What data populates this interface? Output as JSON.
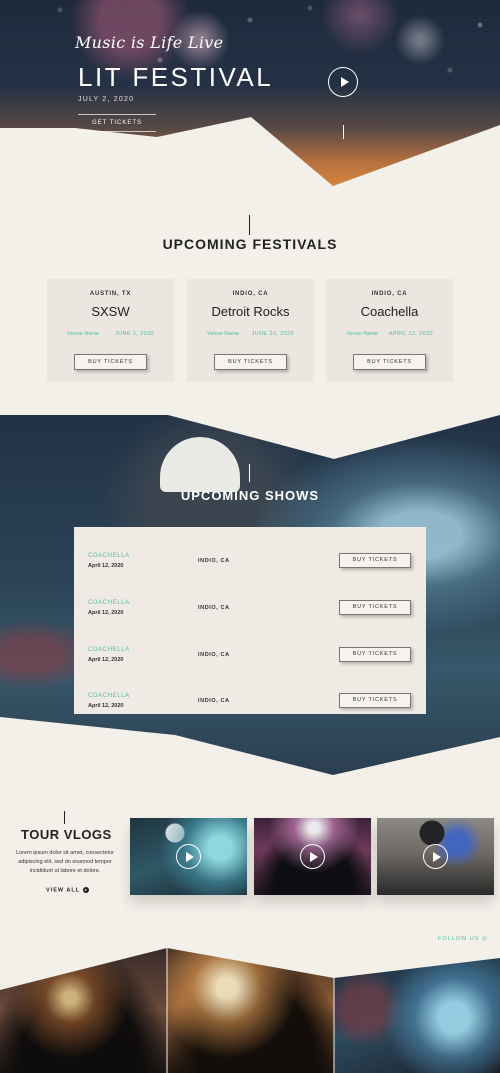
{
  "hero": {
    "tagline": "Music is Life Live",
    "title": "LIT FESTIVAL",
    "date": "JULY 2, 2020",
    "cta": "GET TICKETS"
  },
  "festivals": {
    "title": "UPCOMING FESTIVALS",
    "items": [
      {
        "location": "AUSTIN, TX",
        "name": "SXSW",
        "venue": "Venue Name",
        "date": "JUNE 1, 2020",
        "button": "BUY TICKETS"
      },
      {
        "location": "INDIO, CA",
        "name": "Detroit Rocks",
        "venue": "Venue Name",
        "date": "JUNE 20, 2020",
        "button": "BUY TICKETS"
      },
      {
        "location": "INDIO, CA",
        "name": "Coachella",
        "venue": "Venue Name",
        "date": "APRIL 12, 2020",
        "button": "BUY TICKETS"
      }
    ]
  },
  "shows": {
    "title": "UPCOMING SHOWS",
    "items": [
      {
        "name": "COACHELLA",
        "date": "April 12, 2020",
        "location": "INDIO, CA",
        "button": "BUY TICKETS"
      },
      {
        "name": "COACHELLA",
        "date": "April 12, 2020",
        "location": "INDIO, CA",
        "button": "BUY TICKETS"
      },
      {
        "name": "COACHELLA",
        "date": "April 12, 2020",
        "location": "INDIO, CA",
        "button": "BUY TICKETS"
      },
      {
        "name": "COACHELLA",
        "date": "April 12, 2020",
        "location": "INDIO, CA",
        "button": "BUY TICKETS"
      }
    ]
  },
  "vlogs": {
    "title": "TOUR VLOGS",
    "text": "Lorem ipsum dolor sit amet, consectetur adipiscing elit, sed do eiusmod tempor incididunt ut labore et dolore.",
    "view_all": "VIEW ALL"
  },
  "follow": "FOLLOW US",
  "colors": {
    "accent": "#4bbfa6",
    "background": "#f3efe9",
    "card": "#ebe6df"
  }
}
